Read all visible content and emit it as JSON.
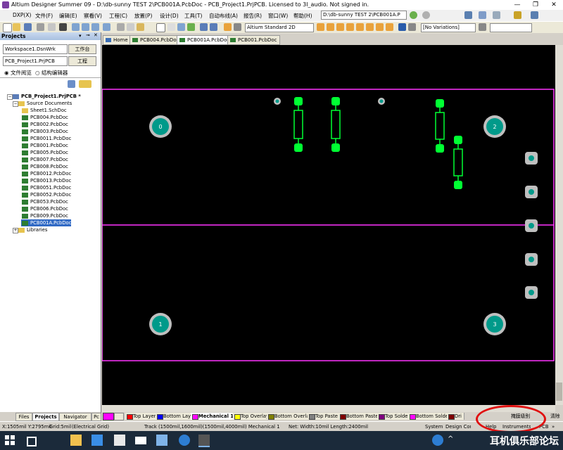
{
  "window": {
    "title": "Altium Designer Summer 09 - D:\\db-sunny TEST 2\\PCB001A.PcbDoc - PCB_Project1.PrjPCB. Licensed to 3l_audio. Not signed in.",
    "controls": [
      "—",
      "❐",
      "✕"
    ]
  },
  "menu": {
    "items": [
      "DXP(X)",
      "文件(F)",
      "编辑(E)",
      "察看(V)",
      "工程(C)",
      "放置(P)",
      "设计(D)",
      "工具(T)",
      "自动布线(A)",
      "报告(R)",
      "窗口(W)",
      "帮助(H)"
    ],
    "path_combo": "D:\\db-sunny TEST 2\\PCB001A.P"
  },
  "toolbar": {
    "view_combo": "Altium Standard 2D",
    "variations_combo": "[No Variations]"
  },
  "panel": {
    "title": "Projects",
    "workspace_combo": "Workspace1.DsnWrk",
    "workspace_button": "工作台",
    "project_field": "PCB_Project1.PrjPCB",
    "project_button": "工程",
    "radio_file_view": "文件阅览",
    "radio_struct_editor": "结构编辑器",
    "tree": {
      "project": "PCB_Project1.PrjPCB *",
      "source_folder": "Source Documents",
      "files": [
        "Sheet1.SchDoc",
        "PCB004.PcbDoc",
        "PCB002.PcbDoc",
        "PCB003.PcbDoc",
        "PCB0011.PcbDoc",
        "PCB001.PcbDoc",
        "PCB005.PcbDoc",
        "PCB007.PcbDoc",
        "PCB008.PcbDoc",
        "PCB0012.PcbDoc",
        "PCB0013.PcbDoc",
        "PCB0051.PcbDoc",
        "PCB0052.PcbDoc",
        "PCB053.PcbDoc",
        "PCB006.PcbDoc",
        "PCB009.PcbDoc",
        "PCB001A.PcbDoc"
      ],
      "selected": "PCB001A.PcbDoc",
      "libraries": "Libraries"
    },
    "tabs": [
      "Files",
      "Projects",
      "Navigator",
      "Pc"
    ]
  },
  "doc_tabs": [
    "Home",
    "PCB004.PcbDoc",
    "PCB001A.PcbDoc",
    "PCB001.PcbDoc"
  ],
  "canvas": {
    "mounting_hole_labels": [
      "0",
      "2",
      "1",
      "3"
    ]
  },
  "layers": {
    "tabs": [
      {
        "label": "Top Layer",
        "color": "#ff0000"
      },
      {
        "label": "Bottom Layer",
        "color": "#0000ff"
      },
      {
        "label": "Mechanical 1",
        "color": "#ff00ff"
      },
      {
        "label": "Top Overlay",
        "color": "#ffff00"
      },
      {
        "label": "Bottom Overlay",
        "color": "#808000"
      },
      {
        "label": "Top Paste",
        "color": "#808080"
      },
      {
        "label": "Bottom Paste",
        "color": "#800000"
      },
      {
        "label": "Top Solder",
        "color": "#800080"
      },
      {
        "label": "Bottom Solder",
        "color": "#ff00ff"
      },
      {
        "label": "Dri",
        "color": "#800000"
      }
    ],
    "right_label": "清除",
    "mask_label": "掩膜级别"
  },
  "status": {
    "coords": "X:1505mil Y:2795mil",
    "grid": "Grid:5mil",
    "grid_type": "(Electrical Grid)",
    "track": "Track (1500mil,1600mil)(1500mil,4000mil)  Mechanical 1",
    "net": "Net: Width:10mil Length:2400mil",
    "right_tabs": [
      "System",
      "Design Compiler",
      "Help",
      "Instruments",
      "PCB",
      "»"
    ]
  },
  "taskbar": {
    "watermark": "耳机俱乐部论坛"
  },
  "colors": {
    "board_outline": "#ff33ff",
    "pad": "#00ff33",
    "mount_hole": "#009a8a",
    "canvas": "#000000"
  }
}
